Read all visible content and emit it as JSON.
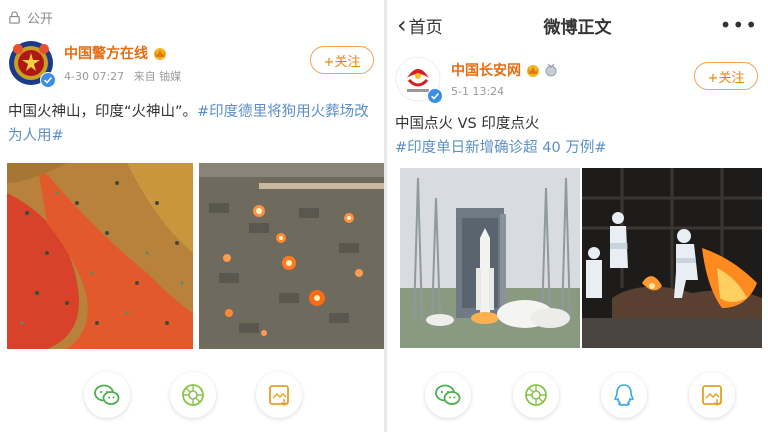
{
  "left_post": {
    "visibility_label": "公开",
    "author_name": "中国警方在线",
    "date": "4-30 07:27",
    "source": "来自 铀媒",
    "follow_label": "+关注",
    "text_main": "中国火神山，印度“火神山”。",
    "hashtag": "#印度德里将狗用火葬场改为人用#",
    "images": [
      "aerial-cremation-ground-red",
      "aerial-mass-cremation-night"
    ]
  },
  "right_post": {
    "back_label": "首页",
    "nav_title": "微博正文",
    "author_name": "中国长安网",
    "date": "5-1 13:24",
    "follow_label": "+关注",
    "text_main": "中国点火 VS 印度点火",
    "hashtag": "#印度单日新增确诊超 40 万例#",
    "images": [
      "rocket-launch-pad",
      "cremation-fire-ppe-workers"
    ]
  },
  "icons": {
    "left_actions": [
      "wechat-icon",
      "moments-icon",
      "save-image-icon"
    ],
    "right_actions": [
      "wechat-icon",
      "moments-icon",
      "qq-icon",
      "save-image-icon"
    ]
  },
  "colors": {
    "name_orange": "#e86b0f",
    "hashtag_blue": "#5b8fc7",
    "follow_border": "#f0a050",
    "action_wechat": "#4cb050",
    "action_moments": "#8bc34a",
    "action_qq": "#38a8e8",
    "action_save": "#e8a020"
  }
}
